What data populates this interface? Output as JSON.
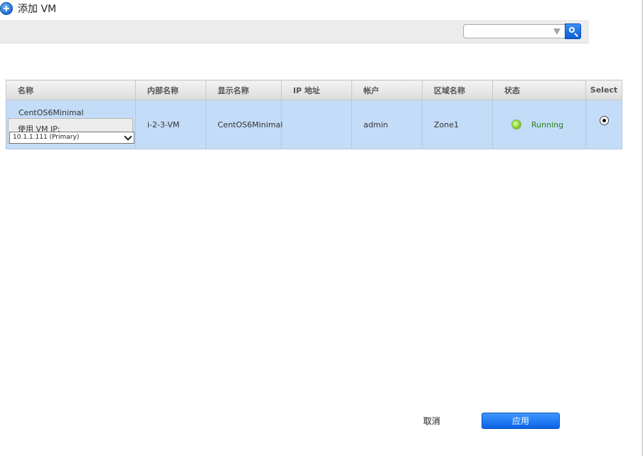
{
  "dialog": {
    "title": "添加 VM",
    "icon": "add-icon"
  },
  "search": {
    "value": "",
    "placeholder": "",
    "icon": "search-icon"
  },
  "table": {
    "columns": [
      "名称",
      "内部名称",
      "显示名称",
      "IP 地址",
      "帐户",
      "区域名称",
      "状态",
      "Select"
    ],
    "rows": [
      {
        "name": "CentOS6Minimal",
        "vm_ip_label": "使用 VM IP:",
        "vm_ip_selected": "10.1.1.111 (Primary)",
        "internal_name": "i-2-3-VM",
        "display_name": "CentOS6Minimal",
        "ip_address": "",
        "account": "admin",
        "zone": "Zone1",
        "state": "Running",
        "selected": true
      }
    ]
  },
  "footer": {
    "cancel_label": "取消",
    "apply_label": "应用"
  },
  "colors": {
    "row_highlight": "#c3dcf7",
    "accent_blue": "#0a62e6",
    "running_green": "#2e7d19"
  }
}
